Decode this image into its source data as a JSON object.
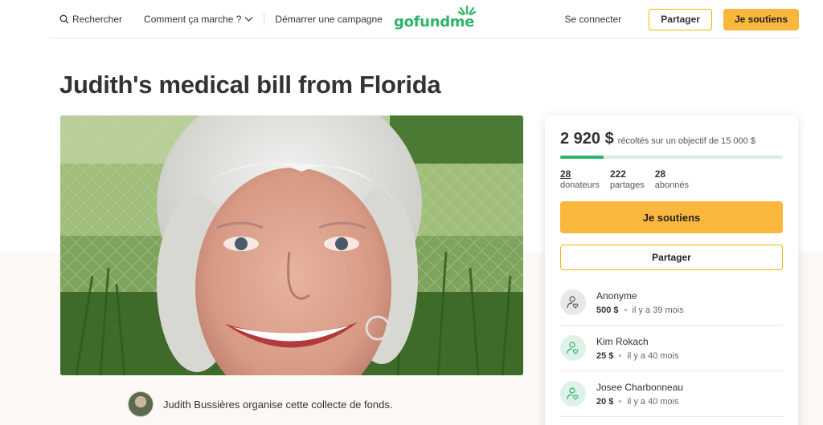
{
  "header": {
    "search_label": "Rechercher",
    "how_label": "Comment ça marche ?",
    "start_label": "Démarrer une campagne",
    "logo_text": "gofundme",
    "signin_label": "Se connecter",
    "share_label": "Partager",
    "donate_label": "Je soutiens"
  },
  "campaign": {
    "title": "Judith's medical bill from Florida",
    "organizer_text": "Judith Bussières organise cette collecte de fonds."
  },
  "card": {
    "raised": "2 920 $",
    "goal_text": "récoltés sur un objectif de 15 000 $",
    "progress_fraction": 0.195,
    "stats": [
      {
        "num": "28",
        "label": "donateurs"
      },
      {
        "num": "222",
        "label": "partages"
      },
      {
        "num": "28",
        "label": "abonnés"
      }
    ],
    "donate_label": "Je soutiens",
    "share_label": "Partager",
    "donations": [
      {
        "name": "Anonyme",
        "amount": "500 $",
        "time": "il y a 39 mois",
        "icon": "donor-heart-icon",
        "tone": "gray"
      },
      {
        "name": "Kim Rokach",
        "amount": "25 $",
        "time": "il y a 40 mois",
        "icon": "donor-heart-icon",
        "tone": "green"
      },
      {
        "name": "Josee Charbonneau",
        "amount": "20 $",
        "time": "il y a 40 mois",
        "icon": "donor-heart-icon",
        "tone": "green"
      }
    ]
  },
  "colors": {
    "brand_green": "#2fb368",
    "accent_yellow": "#f9b73e"
  }
}
